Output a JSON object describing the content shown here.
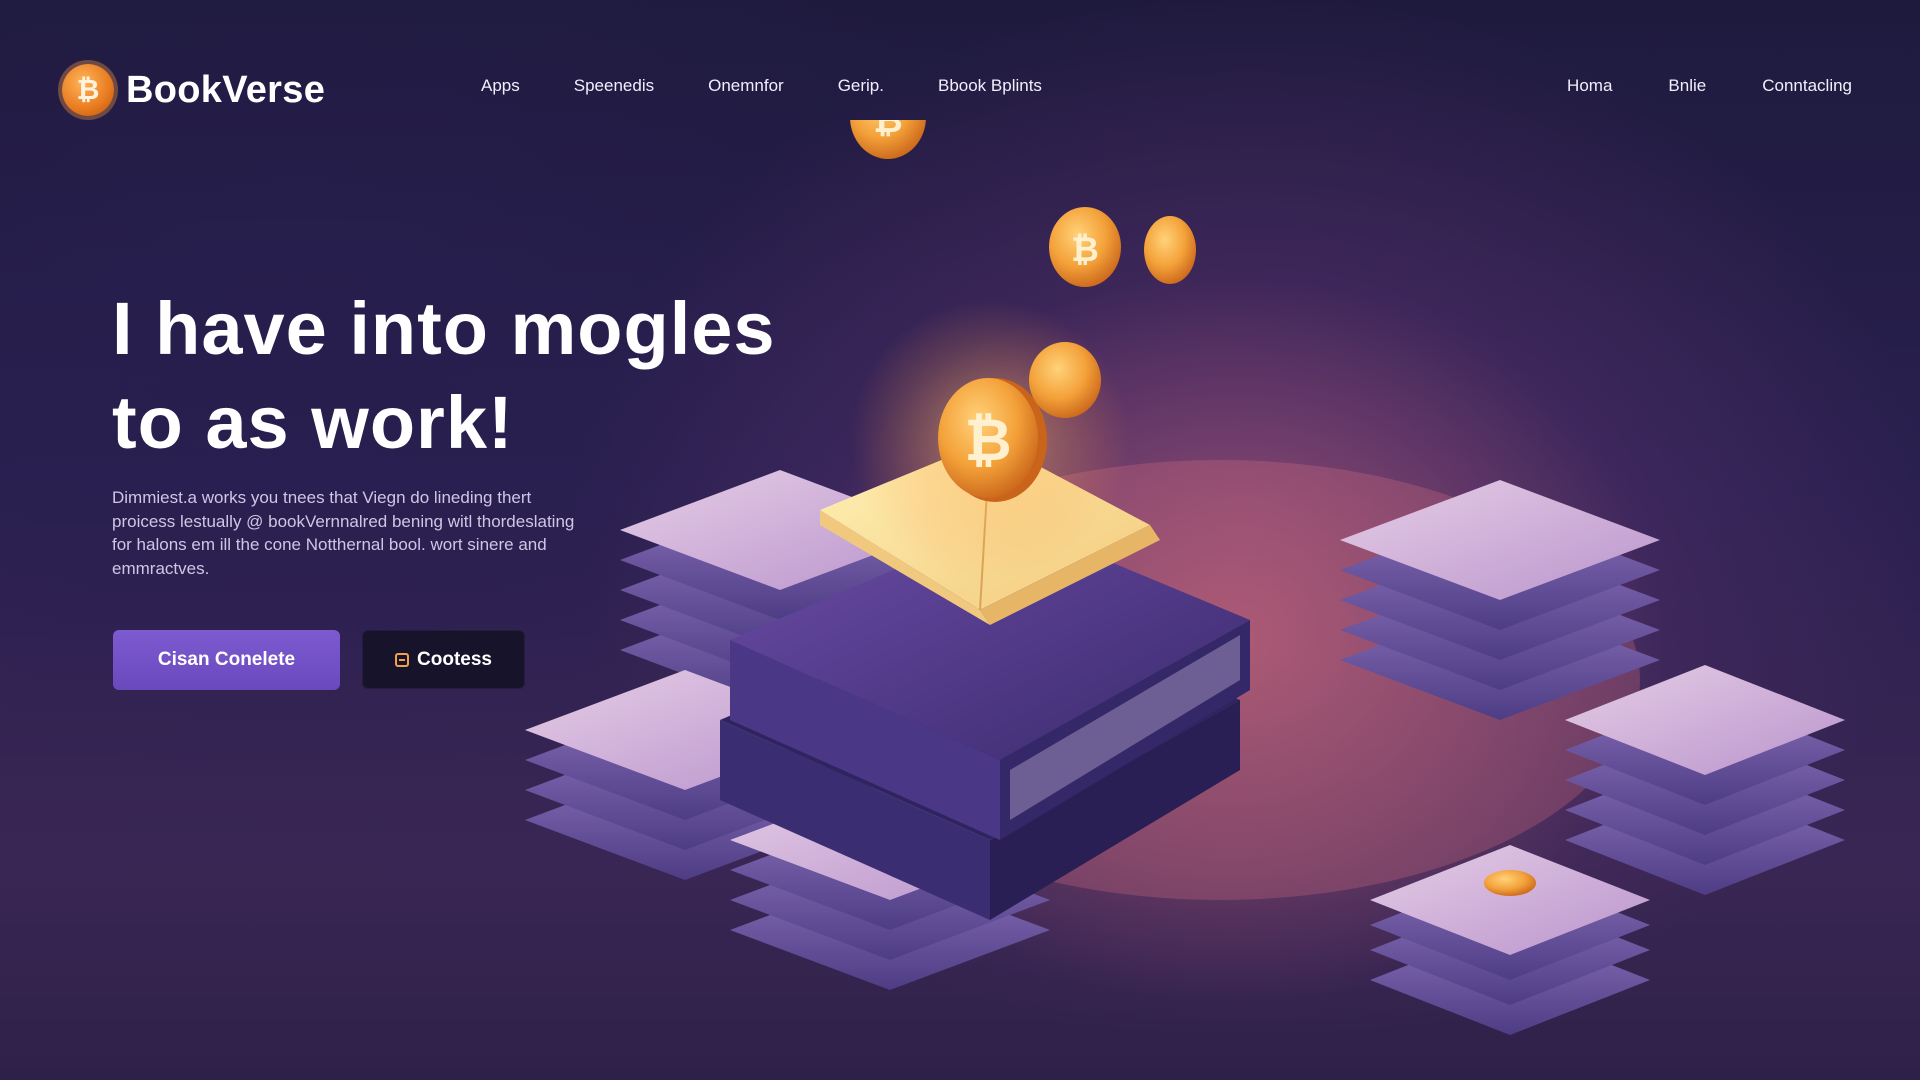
{
  "header": {
    "logo_text": "BookVerse",
    "logo_mark": "₿",
    "nav_left": [
      "Apps",
      "Speenedis",
      "Onemnfor",
      "Gerip.",
      "Bbook Bplints"
    ],
    "nav_right": [
      "Homa",
      "Bnlie",
      "Conntacling"
    ]
  },
  "hero": {
    "title_lines": [
      "I have into mogles",
      "to as work!"
    ],
    "description_lines": [
      "Dimmiest.a works you tnees that Viegn do lineding thert",
      "proicess lestually @ bookVernnalred bening witl thordeslating",
      "for halons em ill the cone Notthernal bool. wort sinere and",
      "emmractves."
    ],
    "primary_button": "Cisan Conelete",
    "secondary_button": "Cootess"
  },
  "illustration": {
    "coin_symbol": "₿",
    "colors": {
      "coin": "#f4a23a",
      "book_cover": "#5a3f93",
      "page_stack": "#c9a7d6",
      "accent_purple": "#6a49bd"
    }
  }
}
